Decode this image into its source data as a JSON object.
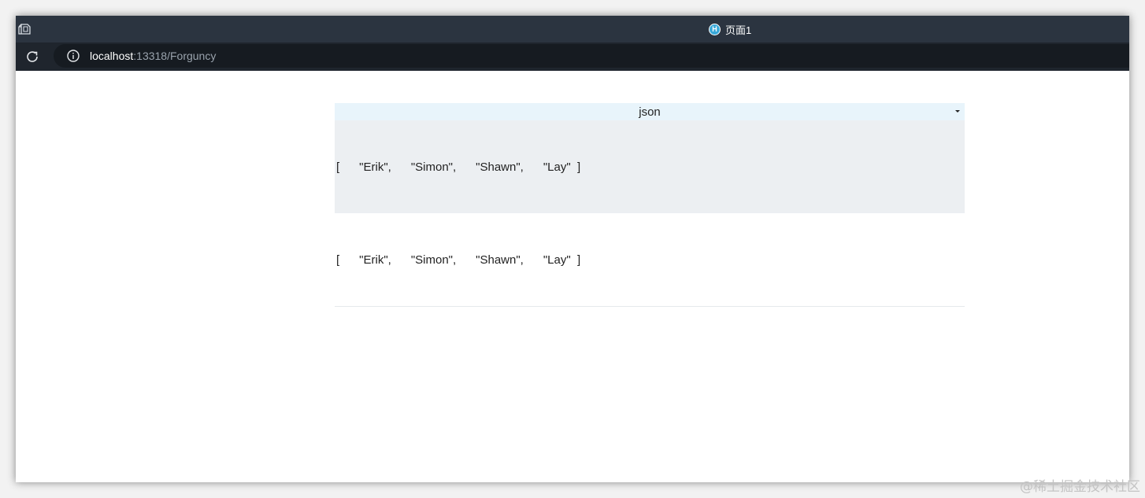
{
  "browser": {
    "tab_title": "页面1",
    "favicon_letter": "H",
    "url_host": "localhost",
    "url_rest": ":13318/Forguncy",
    "icons": {
      "app": "app-icon",
      "reload": "reload-icon",
      "info": "info-icon"
    }
  },
  "page": {
    "select": {
      "value": "json"
    },
    "rows": [
      {
        "text": "[      \"Erik\",      \"Simon\",      \"Shawn\",      \"Lay\"  ]"
      },
      {
        "text": "[      \"Erik\",      \"Simon\",      \"Shawn\",      \"Lay\"  ]"
      }
    ]
  },
  "watermark": "@稀土掘金技术社区",
  "colors": {
    "titlebar": "#2b3440",
    "addressbar": "#1f252d",
    "header_bg": "#e8f4fb",
    "row1_bg": "#eceff2"
  }
}
